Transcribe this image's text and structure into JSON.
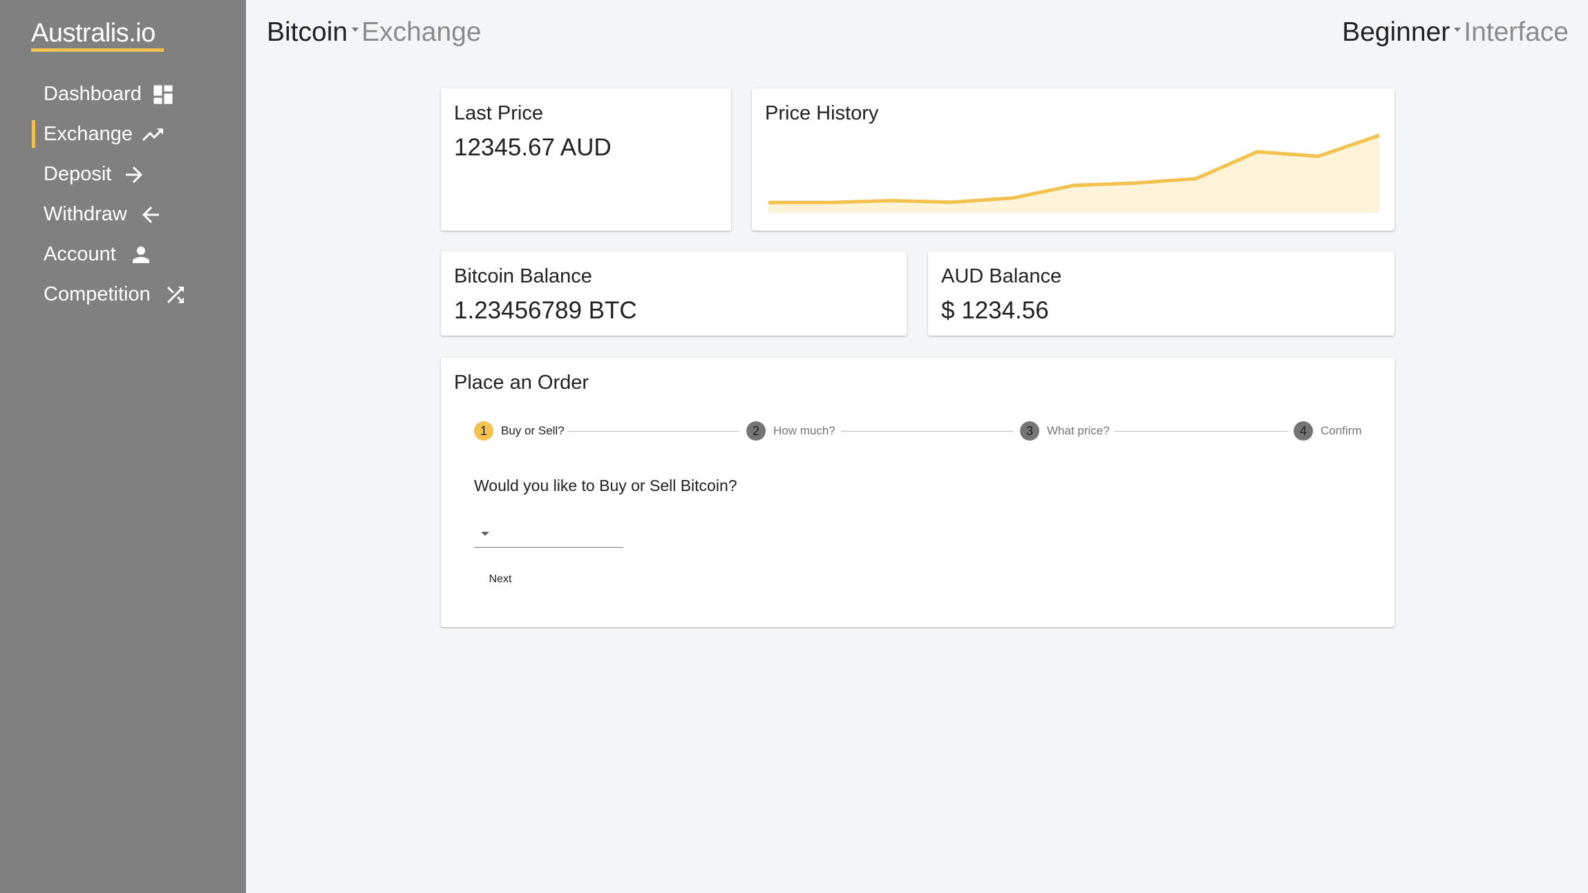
{
  "app": {
    "logo": "Australis.io",
    "accent_color": "#f2c14e",
    "sidebar_color": "#808080"
  },
  "sidebar": {
    "items": [
      {
        "label": "Dashboard",
        "icon": "dashboard-icon",
        "active": false
      },
      {
        "label": "Exchange",
        "icon": "trending-up-icon",
        "active": true
      },
      {
        "label": "Deposit",
        "icon": "arrow-right-icon",
        "active": false
      },
      {
        "label": "Withdraw",
        "icon": "arrow-left-icon",
        "active": false
      },
      {
        "label": "Account",
        "icon": "person-icon",
        "active": false
      },
      {
        "label": "Competition",
        "icon": "shuffle-icon",
        "active": false
      }
    ]
  },
  "header": {
    "currency": "Bitcoin",
    "section": "Exchange",
    "mode": "Beginner",
    "mode_suffix": "Interface"
  },
  "cards": {
    "last_price": {
      "title": "Last Price",
      "value": "12345.67 AUD"
    },
    "price_history": {
      "title": "Price History"
    },
    "btc_balance": {
      "title": "Bitcoin Balance",
      "value": "1.23456789 BTC"
    },
    "aud_balance": {
      "title": "AUD Balance",
      "value": "$ 1234.56"
    }
  },
  "order": {
    "title": "Place an Order",
    "steps": [
      {
        "number": "1",
        "label": "Buy or Sell?",
        "active": true
      },
      {
        "number": "2",
        "label": "How much?",
        "active": false
      },
      {
        "number": "3",
        "label": "What price?",
        "active": false
      },
      {
        "number": "4",
        "label": "Confirm",
        "active": false
      }
    ],
    "question": "Would you like to Buy or Sell Bitcoin?",
    "select_value": "",
    "next_label": "Next"
  },
  "chart_data": {
    "type": "area",
    "title": "Price History",
    "xlabel": "",
    "ylabel": "",
    "x": [
      1,
      2,
      3,
      4,
      5,
      6,
      7,
      8,
      9,
      10,
      11
    ],
    "values": [
      1.0,
      1.0,
      1.25,
      1.05,
      1.6,
      3.3,
      3.6,
      4.2,
      7.8,
      7.2,
      10.0
    ],
    "ylim": [
      0,
      10
    ],
    "grid": false,
    "line_color": "#f2c14e",
    "fill_color": "#fdf3d8"
  }
}
